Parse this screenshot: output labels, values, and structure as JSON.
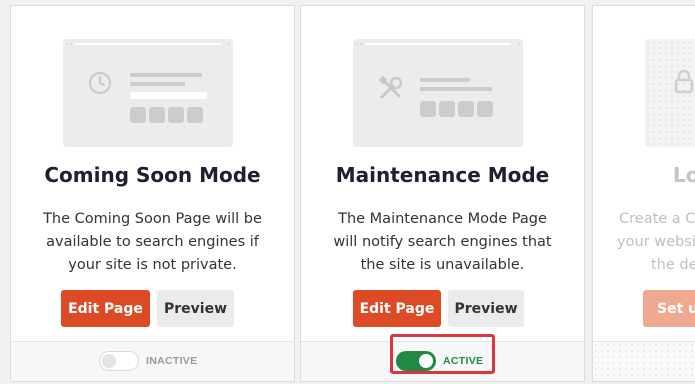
{
  "cards": [
    {
      "title": "Coming Soon Mode",
      "description": "The Coming Soon Page will be available to search engines if your site is not private.",
      "edit_label": "Edit Page",
      "preview_label": "Preview",
      "status": "INACTIVE",
      "icon": "clock-icon"
    },
    {
      "title": "Maintenance Mode",
      "description": "The Maintenance Mode Page will notify search engines that the site is unavailable.",
      "edit_label": "Edit Page",
      "preview_label": "Preview",
      "status": "ACTIVE",
      "icon": "tools-icon"
    },
    {
      "title": "Lo",
      "description_lines": [
        "Create a Cu",
        "your websit",
        "the de"
      ],
      "edit_label": "Set u",
      "icon": "lock-icon"
    }
  ],
  "colors": {
    "accent": "#dd4b26",
    "active": "#1e8a45",
    "highlight": "#d9363e"
  }
}
